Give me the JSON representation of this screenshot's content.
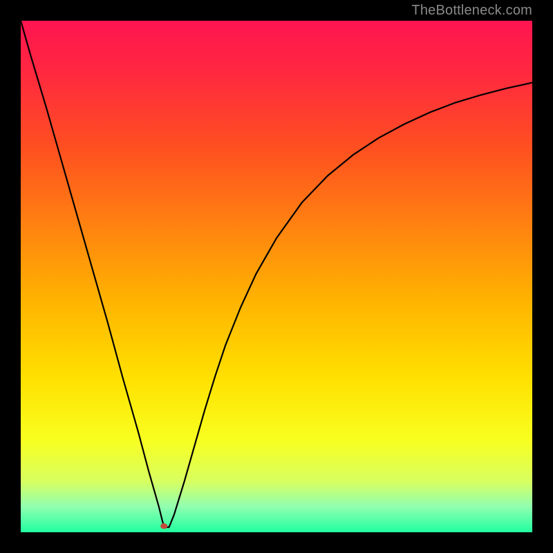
{
  "watermark": {
    "text": "TheBottleneck.com"
  },
  "colors": {
    "frame": "#000000",
    "curve": "#000000",
    "marker": "#c54a3a",
    "gradient_stops": [
      {
        "offset": 0.0,
        "color": "#ff1450"
      },
      {
        "offset": 0.1,
        "color": "#ff2840"
      },
      {
        "offset": 0.25,
        "color": "#ff5020"
      },
      {
        "offset": 0.4,
        "color": "#ff8210"
      },
      {
        "offset": 0.55,
        "color": "#ffb400"
      },
      {
        "offset": 0.7,
        "color": "#ffe100"
      },
      {
        "offset": 0.82,
        "color": "#f8ff20"
      },
      {
        "offset": 0.9,
        "color": "#d8ff60"
      },
      {
        "offset": 0.95,
        "color": "#90ffb0"
      },
      {
        "offset": 1.0,
        "color": "#20ffa0"
      }
    ]
  },
  "chart_data": {
    "type": "line",
    "title": "",
    "xlabel": "",
    "ylabel": "",
    "xlim": [
      0,
      100
    ],
    "ylim": [
      0,
      100
    ],
    "minimum_at_x": 28,
    "series": [
      {
        "name": "curve",
        "x": [
          0,
          2,
          5,
          8,
          11,
          14,
          17,
          20,
          23,
          25,
          26,
          27,
          28,
          29,
          30,
          32,
          34,
          36,
          38,
          40,
          43,
          46,
          50,
          55,
          60,
          65,
          70,
          75,
          80,
          85,
          90,
          95,
          100
        ],
        "y": [
          100,
          93,
          83,
          72.5,
          62,
          51.5,
          41,
          30,
          19.5,
          12,
          8.5,
          5,
          1,
          1,
          3.5,
          10,
          17,
          24,
          30.5,
          36.5,
          44,
          50.5,
          57.5,
          64.5,
          69.7,
          73.8,
          77.1,
          79.8,
          82.1,
          84,
          85.5,
          86.8,
          87.9
        ]
      }
    ],
    "marker": {
      "x": 28,
      "y": 1.2,
      "rx": 5,
      "ry": 4
    }
  }
}
